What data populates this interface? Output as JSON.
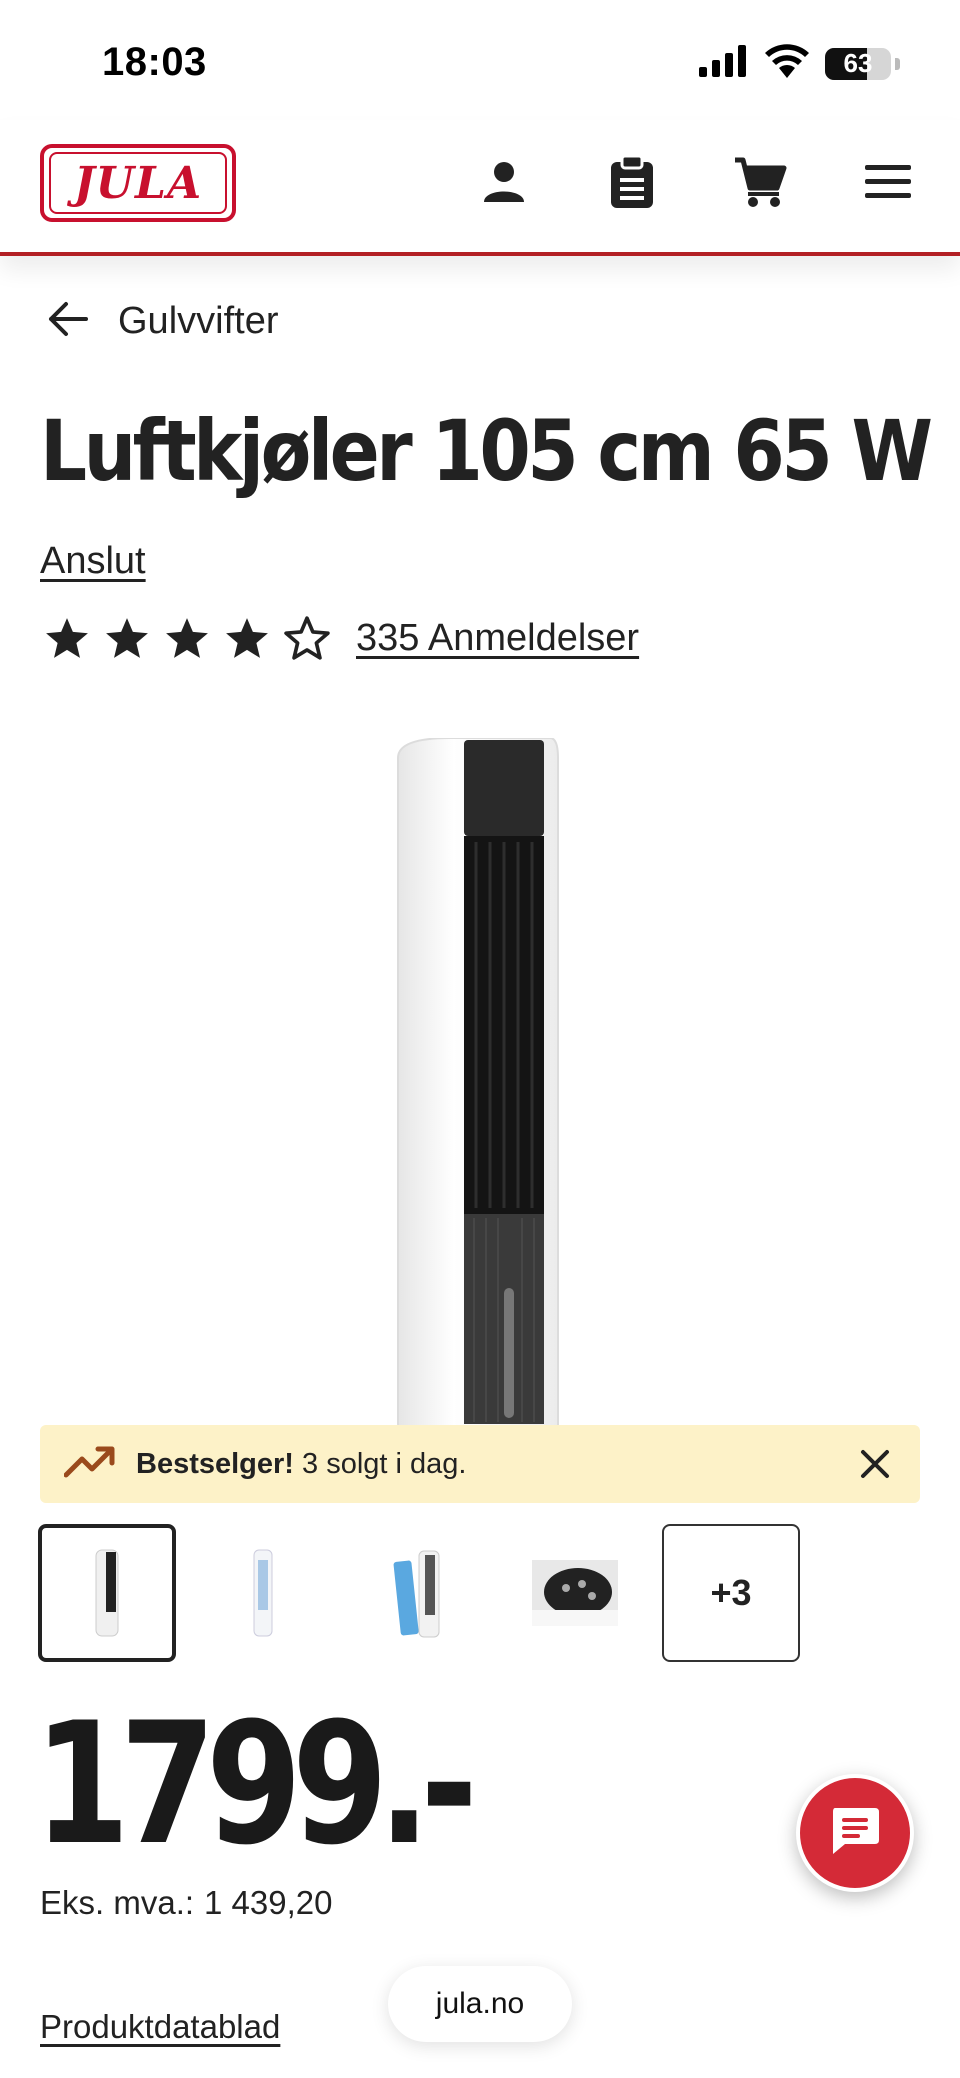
{
  "status_bar": {
    "time": "18:03",
    "battery_level": "63",
    "battery_fraction": 0.63,
    "icons": [
      "signal-icon",
      "wifi-icon",
      "battery-icon"
    ]
  },
  "header": {
    "logo_text": "JULA",
    "icons": [
      "account-icon",
      "clipboard-icon",
      "cart-icon",
      "menu-icon"
    ],
    "accent_color": "#b32025",
    "logo_color": "#c8102e"
  },
  "breadcrumb": {
    "back_icon": "arrow-left-icon",
    "label": "Gulvvifter"
  },
  "product": {
    "title": "Luftkjøler 105 cm 65 W",
    "brand": "Anslut",
    "rating": {
      "value": 4.5,
      "max": 5,
      "reviews_label": "335 Anmeldelser"
    },
    "bestseller": {
      "icon": "trending-up-icon",
      "strong": "Bestselger!",
      "text": "3 solgt i dag.",
      "close_icon": "close-icon",
      "background": "#fdf2c8"
    },
    "thumbnails": {
      "more_label": "+3"
    },
    "price": "1799.-",
    "price_ex_vat_label": "Eks. mva.:",
    "price_ex_vat_value": "1 439,20",
    "datasheet_link": "Produktdatablad"
  },
  "browser": {
    "url": "jula.no"
  },
  "chat": {
    "icon": "chat-icon",
    "color": "#d42a37"
  }
}
